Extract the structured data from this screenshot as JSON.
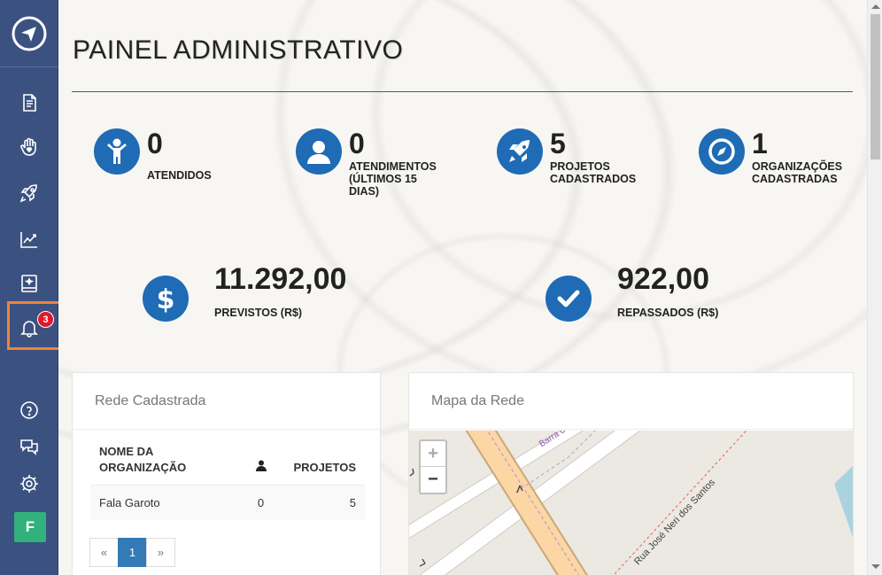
{
  "sidebar": {
    "logo_icon": "compass-arrow-icon",
    "items": [
      {
        "name": "document-icon"
      },
      {
        "name": "hand-heart-icon"
      },
      {
        "name": "rocket-icon"
      },
      {
        "name": "chart-line-icon"
      },
      {
        "name": "book-icon"
      },
      {
        "name": "bell-icon"
      },
      {
        "name": "help-icon"
      },
      {
        "name": "chat-icon"
      },
      {
        "name": "gear-icon"
      }
    ],
    "notification_count": "3",
    "avatar_letter": "F"
  },
  "page": {
    "title": "PAINEL ADMINISTRATIVO"
  },
  "stats": {
    "atendidos": {
      "value": "0",
      "label": "ATENDIDOS"
    },
    "atendimentos15": {
      "value": "0",
      "label": "ATENDIMENTOS (ÚLTIMOS 15 DIAS)"
    },
    "projetos": {
      "value": "5",
      "label": "PROJETOS CADASTRADOS"
    },
    "organizacoes": {
      "value": "1",
      "label": "ORGANIZAÇÕES CADASTRADAS"
    },
    "previstos": {
      "value": "11.292,00",
      "label": "PREVISTOS (R$)"
    },
    "repassados": {
      "value": "922,00",
      "label": "REPASSADOS (R$)"
    }
  },
  "rede": {
    "title": "Rede Cadastrada",
    "columns": [
      "NOME DA ORGANIZAÇÃO",
      "",
      "PROJETOS"
    ],
    "rows": [
      {
        "nome": "Fala Garoto",
        "atendidos": "0",
        "projetos": "5"
      }
    ],
    "pager": {
      "prev": "«",
      "current": "1",
      "next": "»"
    }
  },
  "mapa": {
    "title": "Mapa da Rede",
    "zoom_in": "+",
    "zoom_out": "−",
    "street1": "Barra do",
    "street2": "Rua José Neri dos Santos"
  },
  "colors": {
    "sidebar": "#3b5281",
    "accent": "#1f6bb5",
    "highlight": "#f0823a",
    "badge": "#e0192a",
    "avatar": "#31b27c"
  }
}
